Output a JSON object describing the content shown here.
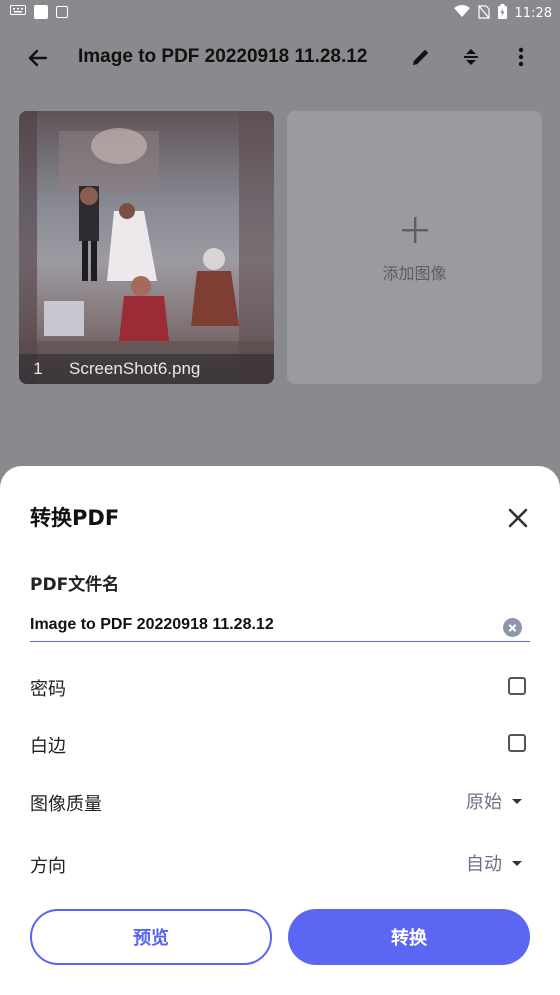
{
  "status_bar": {
    "time": "11:28"
  },
  "appbar": {
    "title": "Image to PDF 20220918 11.28.12"
  },
  "images": [
    {
      "index": "1",
      "filename": "ScreenShot6.png"
    }
  ],
  "add_tile": {
    "label": "添加图像"
  },
  "sheet": {
    "title": "转换PDF",
    "filename_label": "PDF文件名",
    "filename_value": "Image to PDF 20220918 11.28.12",
    "password_label": "密码",
    "password_checked": false,
    "margin_label": "白边",
    "margin_checked": false,
    "quality_label": "图像质量",
    "quality_value": "原始",
    "orientation_label": "方向",
    "orientation_value": "自动",
    "preview_button": "预览",
    "convert_button": "转换"
  },
  "colors": {
    "accent": "#5865f2",
    "scrim": "#8a8a8e"
  }
}
